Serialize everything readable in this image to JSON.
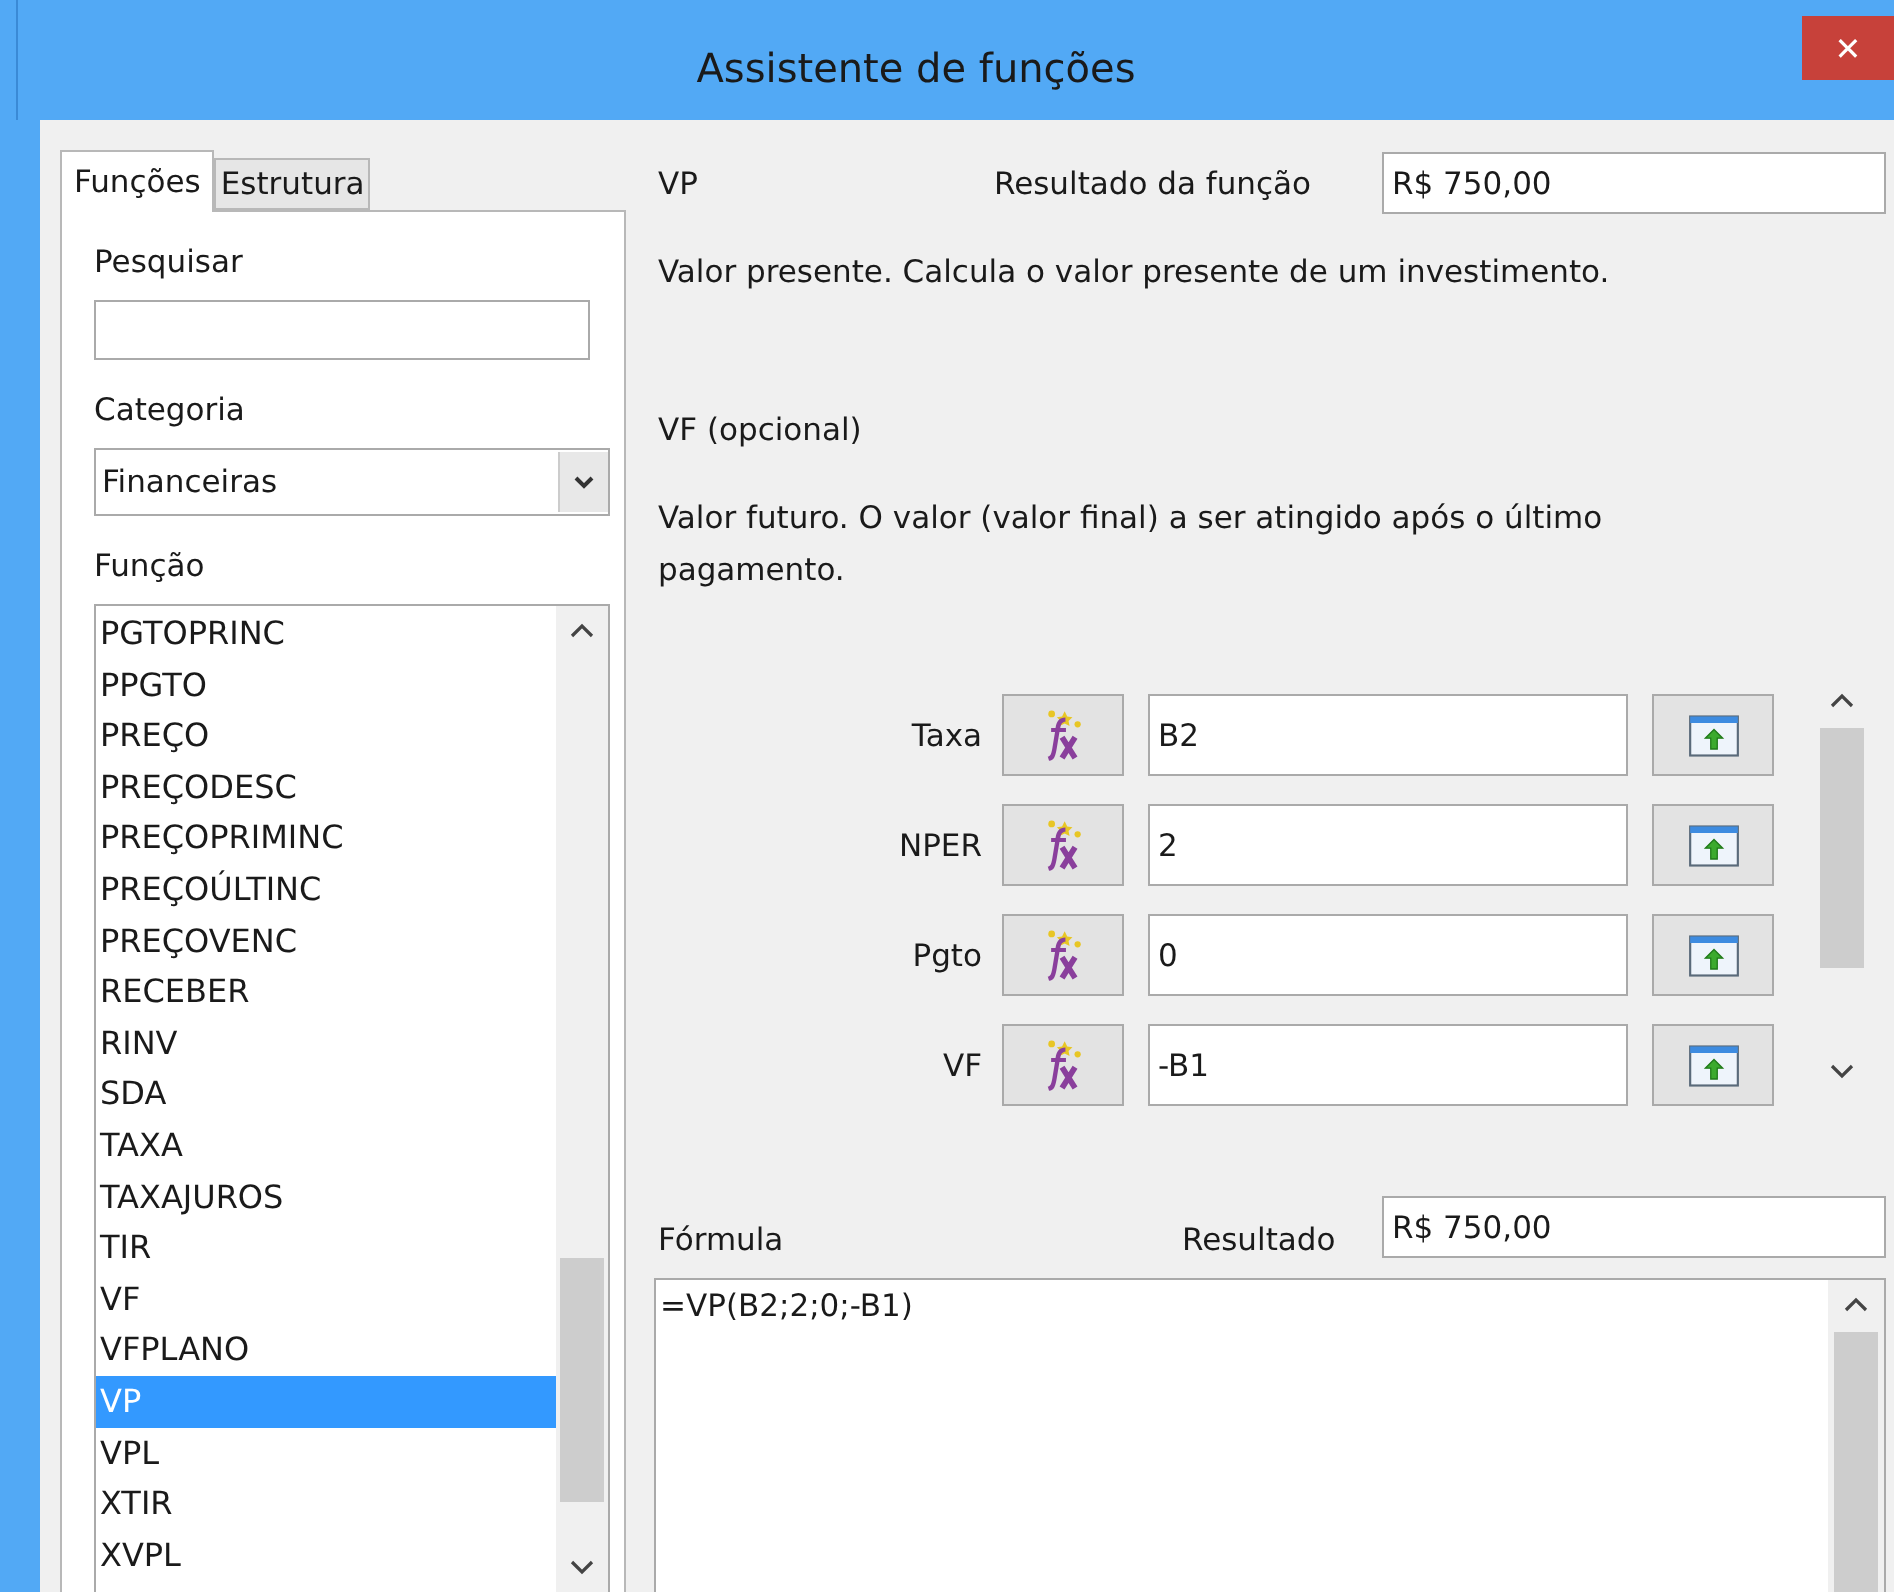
{
  "window": {
    "title": "Assistente de funções",
    "close": "✕"
  },
  "tabs": [
    {
      "label": "Funções",
      "selected": true
    },
    {
      "label": "Estrutura",
      "selected": false
    }
  ],
  "search": {
    "label": "Pesquisar"
  },
  "category": {
    "label": "Categoria",
    "value": "Financeiras"
  },
  "functions": {
    "label": "Função",
    "items": [
      {
        "name": "PGTOPRINC",
        "selected": false
      },
      {
        "name": "PPGTO",
        "selected": false
      },
      {
        "name": "PREÇO",
        "selected": false
      },
      {
        "name": "PREÇODESC",
        "selected": false
      },
      {
        "name": "PREÇOPRIMINC",
        "selected": false
      },
      {
        "name": "PREÇOÚLTINC",
        "selected": false
      },
      {
        "name": "PREÇOVENC",
        "selected": false
      },
      {
        "name": "RECEBER",
        "selected": false
      },
      {
        "name": "RINV",
        "selected": false
      },
      {
        "name": "SDA",
        "selected": false
      },
      {
        "name": "TAXA",
        "selected": false
      },
      {
        "name": "TAXAJUROS",
        "selected": false
      },
      {
        "name": "TIR",
        "selected": false
      },
      {
        "name": "VF",
        "selected": false
      },
      {
        "name": "VFPLANO",
        "selected": false
      },
      {
        "name": "VP",
        "selected": true
      },
      {
        "name": "VPL",
        "selected": false
      },
      {
        "name": "XTIR",
        "selected": false
      },
      {
        "name": "XVPL",
        "selected": false
      }
    ]
  },
  "function_name": "VP",
  "function_result": {
    "label": "Resultado da função",
    "value": "R$ 750,00"
  },
  "function_description": "Valor presente. Calcula o valor presente de um investimento.",
  "argument_title": "VF (opcional)",
  "argument_description": "Valor futuro. O valor (valor final) a ser atingido após o último pagamento.",
  "arguments": [
    {
      "label": "Taxa",
      "value": "B2"
    },
    {
      "label": "NPER",
      "value": "2"
    },
    {
      "label": "Pgto",
      "value": "0"
    },
    {
      "label": "VF",
      "value": "-B1"
    }
  ],
  "formula": {
    "label": "Fórmula",
    "value": "=VP(B2;2;0;-B1)"
  },
  "result": {
    "label": "Resultado",
    "value": "R$ 750,00"
  }
}
